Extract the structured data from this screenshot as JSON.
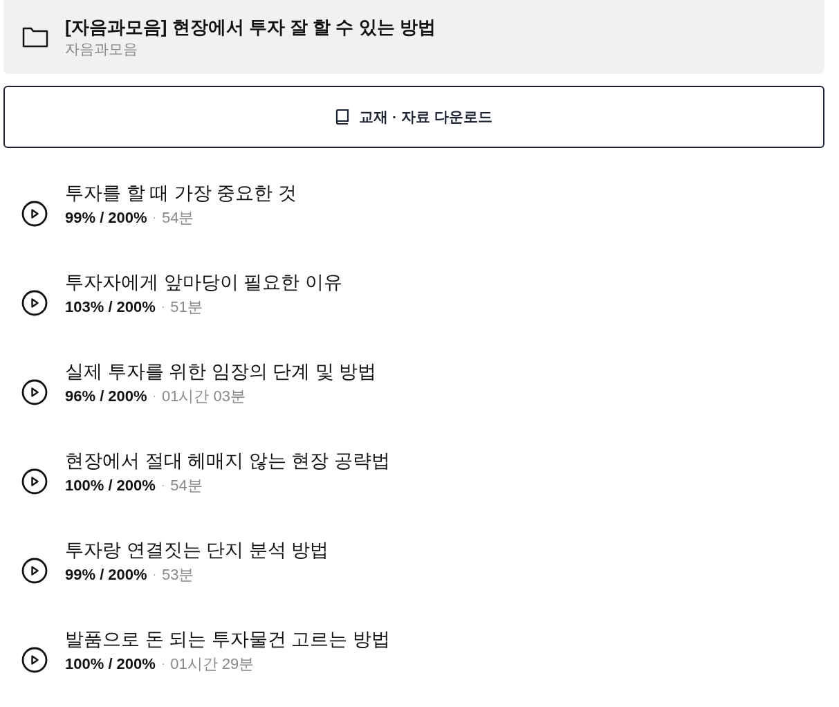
{
  "course": {
    "title": "[자음과모음] 현장에서 투자 잘 할 수 있는 방법",
    "author": "자음과모음"
  },
  "download_button": {
    "label": "교재 · 자료 다운로드"
  },
  "lessons": [
    {
      "title": "투자를 할 때 가장 중요한 것",
      "progress": "99% / 200%",
      "separator": "·",
      "duration": "54분"
    },
    {
      "title": "투자자에게 앞마당이 필요한 이유",
      "progress": "103% / 200%",
      "separator": "·",
      "duration": "51분"
    },
    {
      "title": "실제 투자를 위한 임장의 단계 및 방법",
      "progress": "96% / 200%",
      "separator": "·",
      "duration": "01시간 03분"
    },
    {
      "title": "현장에서 절대 헤매지 않는 현장 공략법",
      "progress": "100% / 200%",
      "separator": "·",
      "duration": "54분"
    },
    {
      "title": "투자랑 연결짓는 단지 분석 방법",
      "progress": "99% / 200%",
      "separator": "·",
      "duration": "53분"
    },
    {
      "title": "발품으로 돈 되는 투자물건 고르는 방법",
      "progress": "100% / 200%",
      "separator": "·",
      "duration": "01시간 29분"
    }
  ]
}
